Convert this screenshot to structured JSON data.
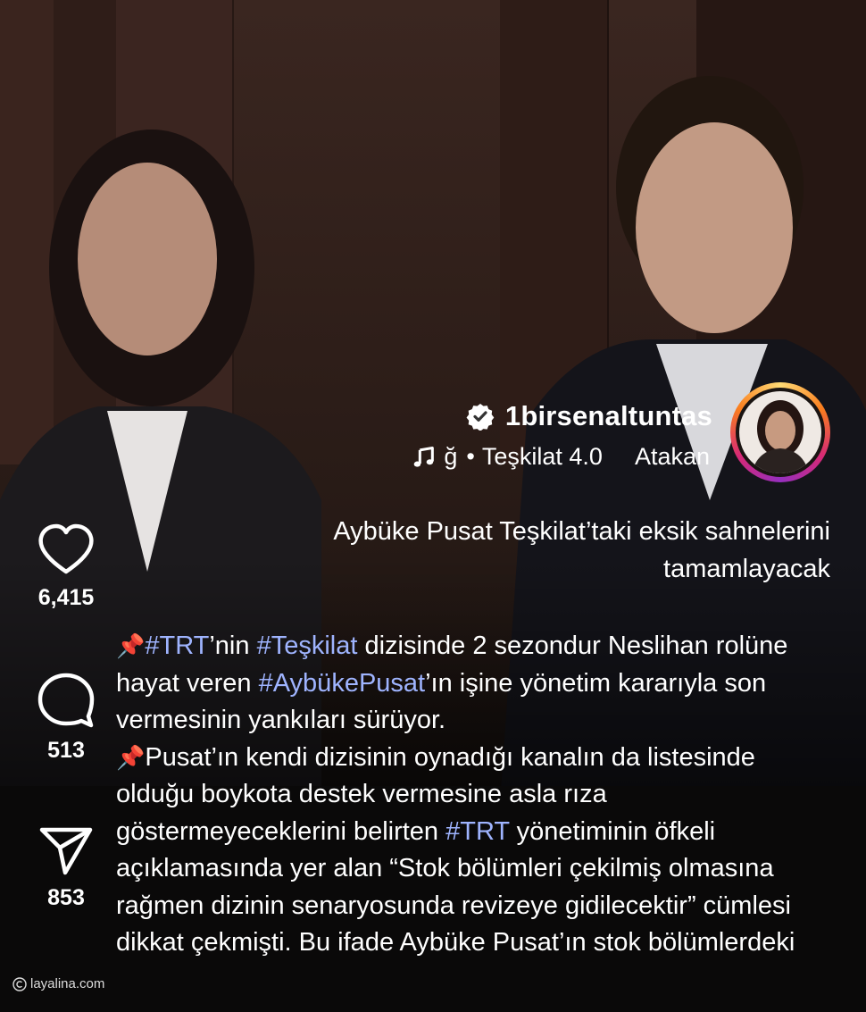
{
  "post": {
    "username": "1birsenaltuntas",
    "music": {
      "title": "ğ",
      "separator": "•",
      "track": "Teşkilat 4.0",
      "artist": "Atakan"
    },
    "headline": "Aybüke Pusat Teşkilat’taki eksik sahnelerini tamamlayacak",
    "caption": {
      "line1_pin": "📌",
      "line1_tag1": "#TRT",
      "line1_text1": "’nin ",
      "line1_tag2": "#Teşkilat",
      "line1_text2": " dizisinde 2 sezondur Neslihan rolüne hayat veren ",
      "line1_tag3": "#AybükePusat",
      "line1_text3": "’ın işine yönetim kararıyla son vermesinin yankıları sürüyor.",
      "line2_pin": "📌",
      "line2_text1": "Pusat’ın kendi dizisinin oynadığı kanalın da listesinde olduğu boykota destek vermesine asla rıza göstermeyeceklerini belirten ",
      "line2_tag1": "#TRT",
      "line2_text2": " yönetiminin öfkeli açıklamasında yer alan “Stok bölümleri çekilmiş olmasına rağmen dizinin senaryosunda revizeye gidilecektir” cümlesi dikkat çekmişti. Bu ifade Aybüke Pusat’ın stok bölümlerdeki"
    }
  },
  "actions": {
    "likes": "6,415",
    "comments": "513",
    "shares": "853"
  },
  "watermark": {
    "text": "layalina.com"
  },
  "colors": {
    "hashtag": "#9fb4ff",
    "text": "#ffffff"
  },
  "icons": [
    "verified-badge-icon",
    "music-note-icon",
    "heart-icon",
    "comment-icon",
    "share-icon",
    "copyright-icon"
  ]
}
